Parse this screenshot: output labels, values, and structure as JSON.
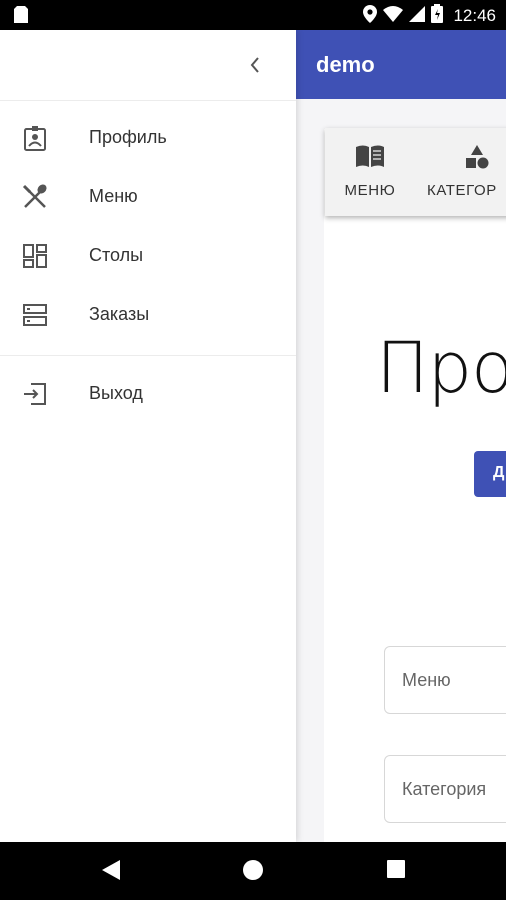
{
  "status_bar": {
    "time": "12:46",
    "icons": [
      "sim-card-icon",
      "location-icon",
      "wifi-icon",
      "signal-icon",
      "battery-icon"
    ]
  },
  "app": {
    "title": "demo",
    "accent_color": "#3f51b5",
    "tabs": [
      {
        "label": "МЕНЮ",
        "icon": "book-icon"
      },
      {
        "label": "КАТЕГОР",
        "icon": "shapes-icon"
      }
    ],
    "heading": "Про",
    "add_button_label": "Д",
    "fields": {
      "menu_placeholder": "Меню",
      "category_placeholder": "Категория"
    }
  },
  "drawer": {
    "collapse_icon": "chevron-left-icon",
    "items": [
      {
        "label": "Профиль",
        "icon": "profile-badge-icon"
      },
      {
        "label": "Меню",
        "icon": "fork-knife-icon"
      },
      {
        "label": "Столы",
        "icon": "grid-icon"
      },
      {
        "label": "Заказы",
        "icon": "list-icon"
      }
    ],
    "logout": {
      "label": "Выход",
      "icon": "logout-icon"
    }
  },
  "nav_bar": {
    "icons": [
      "back-icon",
      "home-icon",
      "recents-icon"
    ]
  }
}
